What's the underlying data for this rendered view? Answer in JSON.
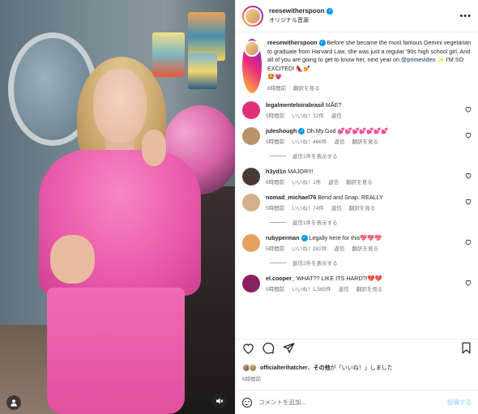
{
  "post": {
    "username": "reesewitherspoon",
    "audio": "オリジナル音源",
    "caption": {
      "username": "reesewitherspoon",
      "text_before_link": "Before she became the most famous Gemini vegetarian to graduate from Harvard Law, she was just a regular '90s high school girl. And all of you are going to get to know her, next year on",
      "link": "@primevideo",
      "text_after_link": "✨ I'M SO EXCITED! 👠💅",
      "second_line": "🤩💗",
      "time": "6時間前",
      "translate": "翻訳を見る"
    },
    "comments": [
      {
        "user": "legalmenteloirabrasil",
        "text": "MÃE?",
        "time": "5時間前",
        "likes": "いいね！32件",
        "reply": "返信",
        "translate": "",
        "verified": false,
        "replies_label": ""
      },
      {
        "user": "juleshough",
        "text": "Oh.My.God 💕💕💕💕💕💕💕",
        "time": "5時間前",
        "likes": "いいね！466件",
        "reply": "返信",
        "translate": "翻訳を見る",
        "verified": true,
        "replies_label": "返信1件を表示する"
      },
      {
        "user": "h3yd1n",
        "text": "MAJOR!!!",
        "time": "6時間前",
        "likes": "いいね！1件",
        "reply": "返信",
        "translate": "翻訳を見る",
        "verified": false,
        "replies_label": ""
      },
      {
        "user": "nomad_michael76",
        "text": "Bend and Snap. REALLY",
        "time": "5時間前",
        "likes": "いいね！74件",
        "reply": "返信",
        "translate": "翻訳を見る",
        "verified": false,
        "replies_label": "返信1件を表示する"
      },
      {
        "user": "rubyperman",
        "text": "Legally here for this💖💖💖",
        "time": "5時間前",
        "likes": "いいね！282件",
        "reply": "返信",
        "translate": "翻訳を見る",
        "verified": true,
        "replies_label": "返信2件を表示する"
      },
      {
        "user": "el.cooper_",
        "text": "WHAT?? LIKE ITS HARD?!💔💔",
        "time": "5時間前",
        "likes": "いいね！1,565件",
        "reply": "返信",
        "translate": "翻訳を見る",
        "verified": false,
        "replies_label": ""
      }
    ],
    "liked_by": {
      "user": "officialterihatcher",
      "joiner": "、",
      "others": "その他",
      "suffix": "が「いいね！」しました"
    },
    "post_time": "6時間前",
    "comment_placeholder": "コメントを追加...",
    "post_button": "投稿する",
    "icons": {
      "more": "more-horizontal-icon",
      "heart": "heart-icon",
      "comment": "comment-icon",
      "share": "share-icon",
      "save": "bookmark-icon",
      "emoji": "emoji-icon",
      "user_tag": "user-tag-icon",
      "mute": "muted-speaker-icon"
    },
    "colors": {
      "accent": "#0095f6",
      "link": "#00376b",
      "secondary": "#737373"
    }
  }
}
